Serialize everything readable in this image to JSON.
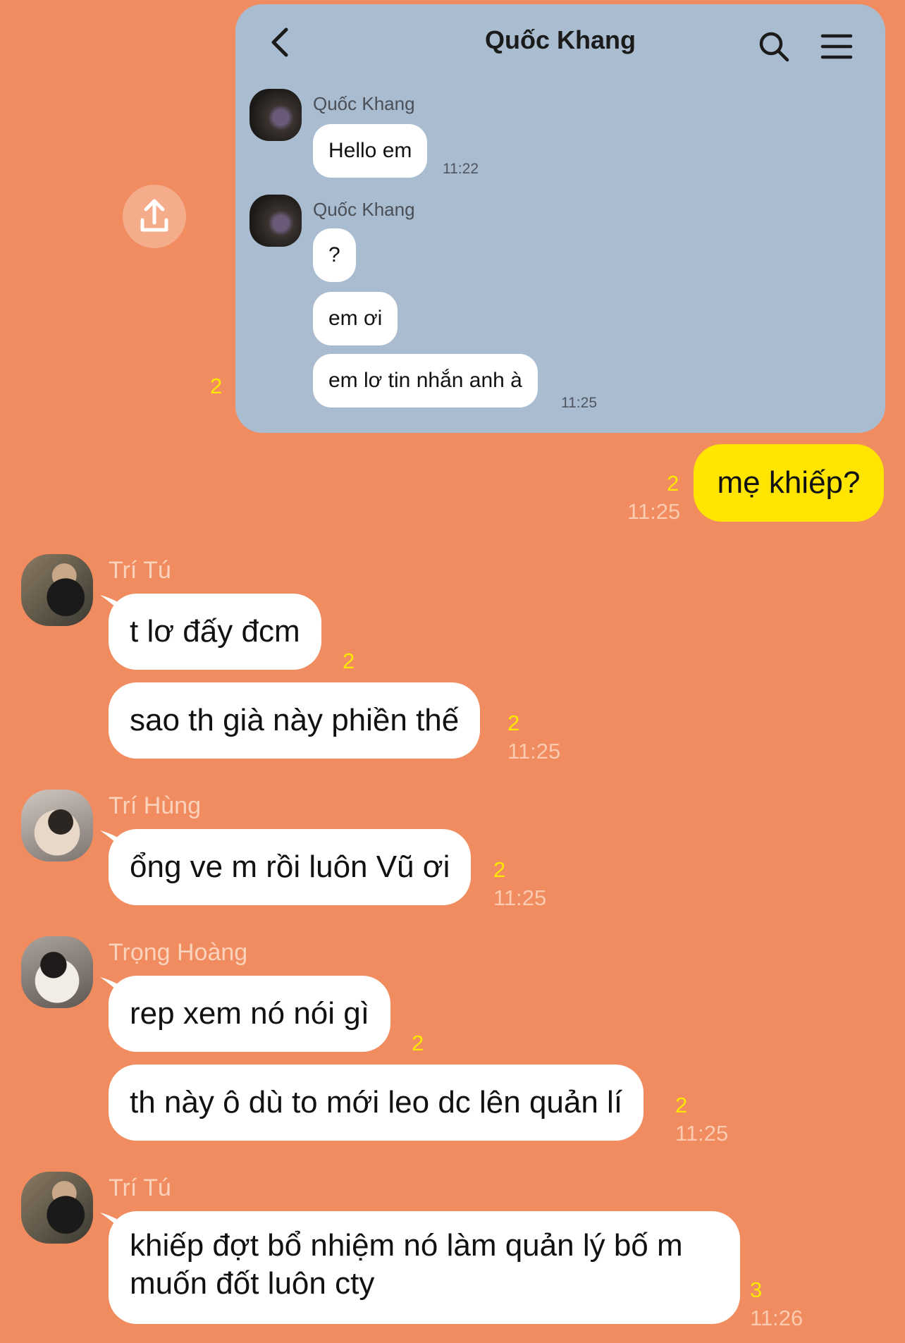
{
  "embedded": {
    "title": "Quốc Khang",
    "groups": [
      {
        "sender": "Quốc Khang",
        "messages": [
          "Hello em"
        ],
        "time": "11:22"
      },
      {
        "sender": "Quốc Khang",
        "messages": [
          "?",
          "em ơi",
          "em lơ tin nhắn anh à"
        ],
        "time": "11:25"
      }
    ],
    "read_count": "2"
  },
  "outgoing": {
    "text": "mẹ khiếp?",
    "count": "2",
    "time": "11:25"
  },
  "groups": [
    {
      "sender": "Trí Tú",
      "messages": [
        {
          "text": "t lơ đấy đcm",
          "count": "2"
        },
        {
          "text": "sao th già này phiền thế",
          "count": "2",
          "time": "11:25"
        }
      ]
    },
    {
      "sender": "Trí Hùng",
      "messages": [
        {
          "text": "ổng ve m rồi luôn Vũ ơi",
          "count": "2",
          "time": "11:25"
        }
      ]
    },
    {
      "sender": "Trọng Hoàng",
      "messages": [
        {
          "text": "rep xem nó nói gì",
          "count": "2"
        },
        {
          "text": "th này ô dù to mới leo dc lên quản lí",
          "count": "2",
          "time": "11:25"
        }
      ]
    },
    {
      "sender": "Trí Tú",
      "messages": [
        {
          "text": "khiếp đợt bổ nhiệm nó làm quản lý bố m muốn đốt luôn cty",
          "count": "3",
          "time": "11:26"
        }
      ]
    }
  ],
  "colors": {
    "background": "#F08C5F",
    "card": "#AABDD0",
    "outgoing_bubble": "#FFE500",
    "read_count": "#FFE800"
  },
  "icons": [
    "back-arrow-icon",
    "search-icon",
    "menu-icon",
    "share-icon"
  ]
}
